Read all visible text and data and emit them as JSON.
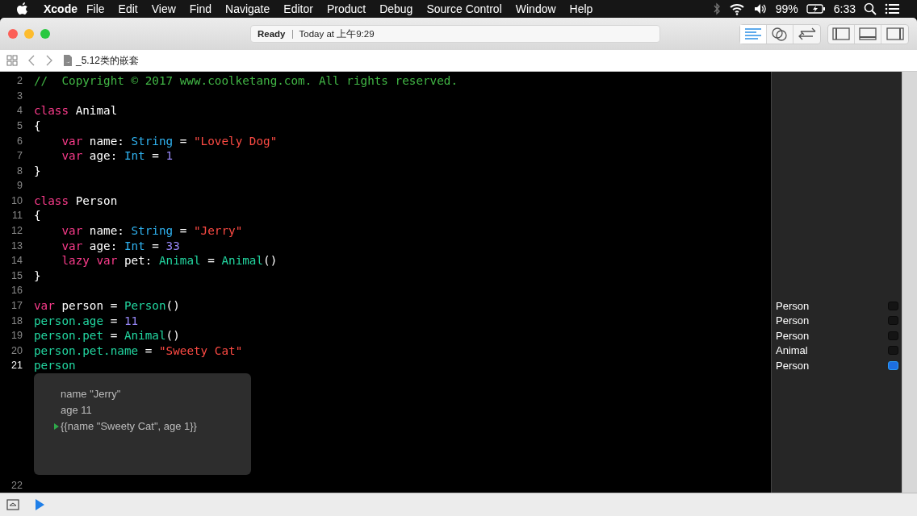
{
  "menu_bar": {
    "app": "Xcode",
    "items": [
      "File",
      "Edit",
      "View",
      "Find",
      "Navigate",
      "Editor",
      "Product",
      "Debug",
      "Source Control",
      "Window",
      "Help"
    ],
    "battery": "99%",
    "time": "6:33"
  },
  "toolbar": {
    "status": "Ready",
    "activity": "Today at 上午9:29",
    "editor_modes": [
      {
        "kind": "standard",
        "selected": true
      },
      {
        "kind": "assistant",
        "selected": false
      },
      {
        "kind": "version",
        "selected": false
      }
    ]
  },
  "jump_bar": {
    "file": "_5.12类的嵌套"
  },
  "editor": {
    "lines": [
      {
        "number": "2",
        "tokens": [
          {
            "kind": "comment",
            "text": "//  Copyright © 2017 www.coolketang.com. All rights reserved."
          }
        ]
      },
      {
        "number": "3"
      },
      {
        "number": "4",
        "tokens": [
          {
            "kind": "keyword",
            "text": "class"
          },
          {
            "kind": "plain",
            "text": " Animal"
          }
        ]
      },
      {
        "number": "5",
        "tokens": [
          {
            "kind": "plain",
            "text": "{"
          }
        ]
      },
      {
        "number": "6",
        "indented": true,
        "tokens": [
          {
            "kind": "keyword",
            "text": "var"
          },
          {
            "kind": "plain",
            "text": " name: "
          },
          {
            "kind": "type",
            "text": "String"
          },
          {
            "kind": "plain",
            "text": " = "
          },
          {
            "kind": "string",
            "text": "\"Lovely Dog\""
          }
        ]
      },
      {
        "number": "7",
        "indented": true,
        "tokens": [
          {
            "kind": "keyword",
            "text": "var"
          },
          {
            "kind": "plain",
            "text": " age: "
          },
          {
            "kind": "type",
            "text": "Int"
          },
          {
            "kind": "plain",
            "text": " = "
          },
          {
            "kind": "number",
            "text": "1"
          }
        ]
      },
      {
        "number": "8",
        "tokens": [
          {
            "kind": "plain",
            "text": "}"
          }
        ]
      },
      {
        "number": "9"
      },
      {
        "number": "10",
        "tokens": [
          {
            "kind": "keyword",
            "text": "class"
          },
          {
            "kind": "plain",
            "text": " Person"
          }
        ]
      },
      {
        "number": "11",
        "tokens": [
          {
            "kind": "plain",
            "text": "{"
          }
        ]
      },
      {
        "number": "12",
        "indented": true,
        "tokens": [
          {
            "kind": "keyword",
            "text": "var"
          },
          {
            "kind": "plain",
            "text": " name: "
          },
          {
            "kind": "type",
            "text": "String"
          },
          {
            "kind": "plain",
            "text": " = "
          },
          {
            "kind": "string",
            "text": "\"Jerry\""
          }
        ]
      },
      {
        "number": "13",
        "indented": true,
        "tokens": [
          {
            "kind": "keyword",
            "text": "var"
          },
          {
            "kind": "plain",
            "text": " age: "
          },
          {
            "kind": "type",
            "text": "Int"
          },
          {
            "kind": "plain",
            "text": " = "
          },
          {
            "kind": "number",
            "text": "33"
          }
        ]
      },
      {
        "number": "14",
        "indented": true,
        "tokens": [
          {
            "kind": "keyword",
            "text": "lazy var"
          },
          {
            "kind": "plain",
            "text": " pet: "
          },
          {
            "kind": "member",
            "text": "Animal"
          },
          {
            "kind": "plain",
            "text": " = "
          },
          {
            "kind": "member",
            "text": "Animal"
          },
          {
            "kind": "plain",
            "text": "()"
          }
        ]
      },
      {
        "number": "15",
        "tokens": [
          {
            "kind": "plain",
            "text": "}"
          }
        ]
      },
      {
        "number": "16"
      },
      {
        "number": "17",
        "tokens": [
          {
            "kind": "keyword",
            "text": "var"
          },
          {
            "kind": "plain",
            "text": " person = "
          },
          {
            "kind": "member",
            "text": "Person"
          },
          {
            "kind": "plain",
            "text": "()"
          }
        ],
        "result": {
          "text": "Person",
          "selected": false
        }
      },
      {
        "number": "18",
        "tokens": [
          {
            "kind": "member",
            "text": "person.age"
          },
          {
            "kind": "plain",
            "text": " = "
          },
          {
            "kind": "number",
            "text": "11"
          }
        ],
        "result": {
          "text": "Person",
          "selected": false
        }
      },
      {
        "number": "19",
        "tokens": [
          {
            "kind": "member",
            "text": "person.pet"
          },
          {
            "kind": "plain",
            "text": " = "
          },
          {
            "kind": "member",
            "text": "Animal"
          },
          {
            "kind": "plain",
            "text": "()"
          }
        ],
        "result": {
          "text": "Person",
          "selected": false
        }
      },
      {
        "number": "20",
        "tokens": [
          {
            "kind": "member",
            "text": "person.pet.name"
          },
          {
            "kind": "plain",
            "text": " = "
          },
          {
            "kind": "string",
            "text": "\"Sweety Cat\""
          }
        ],
        "result": {
          "text": "Animal",
          "selected": false
        }
      },
      {
        "number": "21",
        "current": true,
        "tokens": [
          {
            "kind": "member",
            "text": "person"
          }
        ],
        "result": {
          "text": "Person",
          "selected": true
        }
      }
    ],
    "inline_result": {
      "fields": [
        {
          "text": "name \"Jerry\"",
          "expandable": false
        },
        {
          "text": "age 11",
          "expandable": false
        },
        {
          "text": "{{name \"Sweety Cat\", age 1}}",
          "expandable": true
        }
      ]
    },
    "after_lines": [
      {
        "number": "22"
      }
    ]
  }
}
